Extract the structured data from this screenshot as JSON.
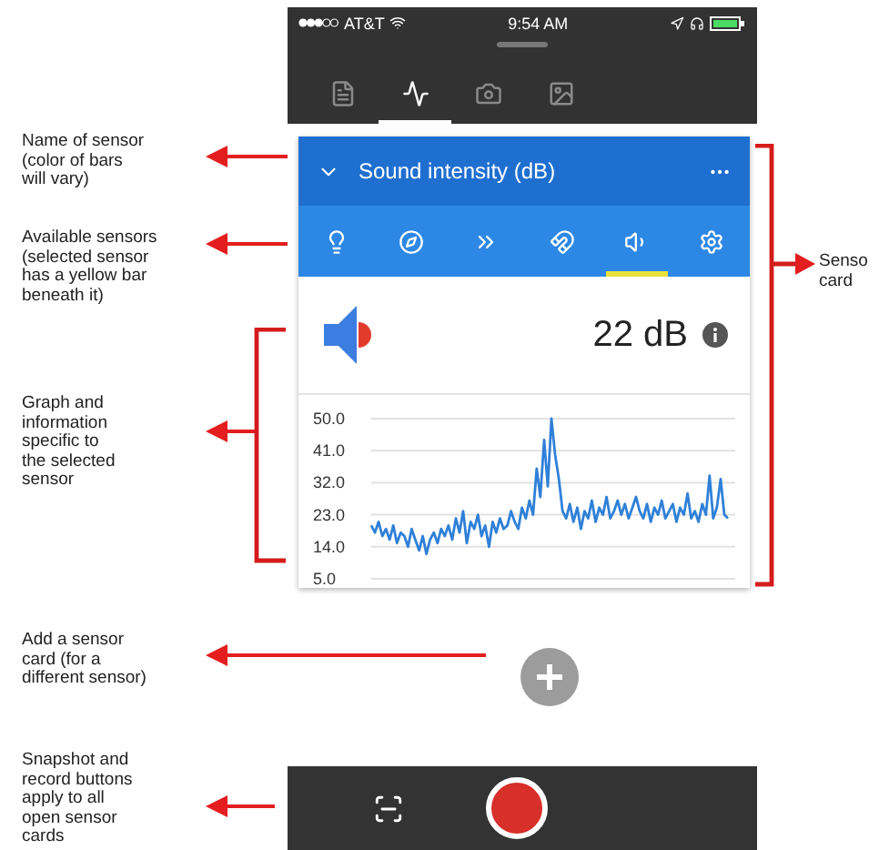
{
  "status_bar": {
    "carrier": "AT&T",
    "time": "9:54 AM"
  },
  "tabs": [
    {
      "kind": "notes",
      "selected": false
    },
    {
      "kind": "sensors",
      "selected": true
    },
    {
      "kind": "camera",
      "selected": false
    },
    {
      "kind": "gallery",
      "selected": false
    }
  ],
  "sensor_card": {
    "title": "Sound intensity (dB)",
    "sensors": [
      {
        "kind": "light",
        "selected": false
      },
      {
        "kind": "compass",
        "selected": false
      },
      {
        "kind": "linear",
        "selected": false
      },
      {
        "kind": "magnet",
        "selected": false
      },
      {
        "kind": "sound",
        "selected": true
      },
      {
        "kind": "settings",
        "selected": false
      }
    ],
    "reading": "22 dB",
    "chart_data": {
      "type": "line",
      "grid": true,
      "ylim": [
        5,
        50
      ],
      "yticks": [
        {
          "value": 5,
          "label": "5.0"
        },
        {
          "value": 14,
          "label": "14.0"
        },
        {
          "value": 23,
          "label": "23.0"
        },
        {
          "value": 32,
          "label": "32.0"
        },
        {
          "value": 41,
          "label": "41.0"
        },
        {
          "value": 50,
          "label": "50.0"
        }
      ],
      "series": [
        {
          "color": "#2f80d8",
          "values": [
            20,
            18,
            21,
            17,
            19,
            16,
            20,
            15,
            18,
            17,
            14,
            19,
            16,
            13,
            17,
            12,
            16,
            18,
            15,
            19,
            17,
            20,
            16,
            22,
            18,
            24,
            15,
            21,
            19,
            23,
            17,
            20,
            14,
            21,
            18,
            22,
            19,
            20,
            24,
            21,
            19,
            25,
            22,
            27,
            23,
            36,
            28,
            44,
            31,
            50,
            40,
            33,
            24,
            22,
            26,
            21,
            25,
            19,
            24,
            22,
            27,
            21,
            25,
            23,
            28,
            22,
            24,
            27,
            23,
            26,
            22,
            25,
            28,
            24,
            22,
            26,
            21,
            25,
            23,
            27,
            22,
            24,
            26,
            21,
            25,
            23,
            29,
            22,
            24,
            21,
            26,
            23,
            34,
            22,
            25,
            33,
            23,
            22
          ]
        }
      ]
    }
  },
  "annotations": [
    {
      "text": "Name of sensor\n(color of bars\nwill vary)"
    },
    {
      "text": "Available sensors\n(selected sensor\nhas a yellow bar\nbeneath it)"
    },
    {
      "text": "Graph and\ninformation\nspecific to\nthe selected\nsensor"
    },
    {
      "text": "Add a sensor\ncard (for a\ndifferent sensor)"
    },
    {
      "text": "Snapshot and\nrecord buttons\napply to all\nopen sensor\ncards"
    }
  ],
  "card_annotation": {
    "text": "Senso\ncard"
  }
}
